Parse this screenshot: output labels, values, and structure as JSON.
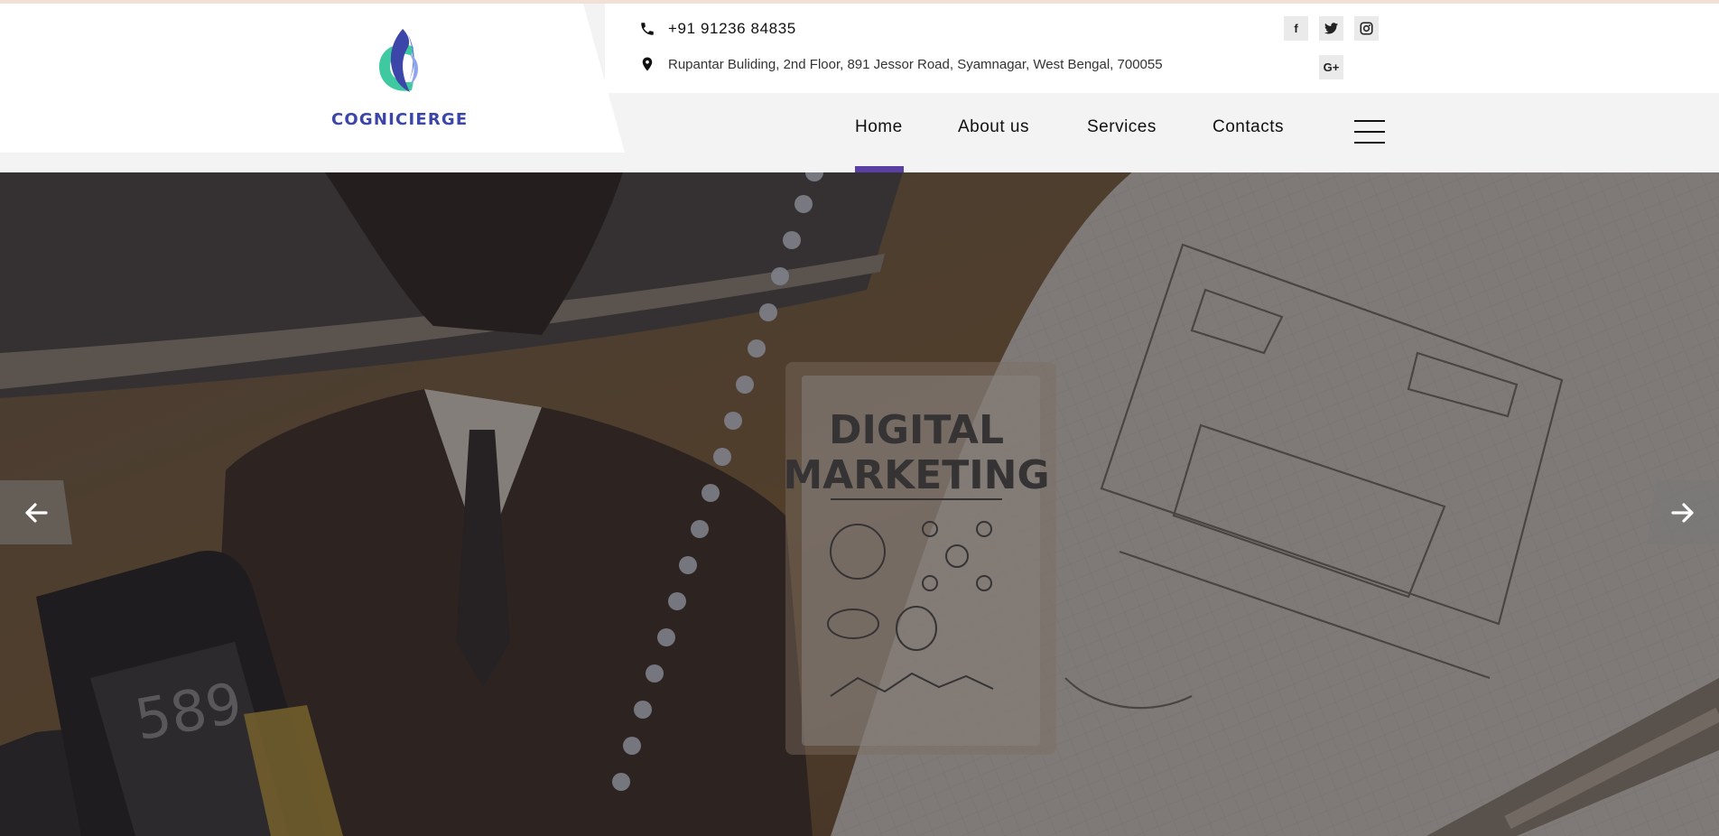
{
  "brand": {
    "name": "COGNICIERGE",
    "logo_icon": "c-flame-logo-icon"
  },
  "contact": {
    "phone": "+91 91236 84835",
    "phone_icon": "phone-icon",
    "address": "Rupantar Buliding, 2nd Floor, 891 Jessor Road, Syamnagar, West Bengal, 700055",
    "address_icon": "map-pin-icon"
  },
  "social": [
    {
      "name": "facebook-icon",
      "glyph": "f"
    },
    {
      "name": "twitter-icon",
      "glyph": "🐦"
    },
    {
      "name": "instagram-icon",
      "glyph": "◎"
    },
    {
      "name": "google-plus-icon",
      "glyph": "G+"
    }
  ],
  "nav": {
    "items": [
      {
        "label": "Home",
        "active": true
      },
      {
        "label": "About us",
        "active": false
      },
      {
        "label": "Services",
        "active": false
      },
      {
        "label": "Contacts",
        "active": false
      }
    ],
    "menu_icon": "hamburger-menu-icon"
  },
  "hero": {
    "image_subject": "businessman with laptop and notebook sketches",
    "clipboard_title_line1": "DIGITAL",
    "clipboard_title_line2": "MARKETING",
    "calculator_display": "589",
    "prev_icon": "arrow-left-icon",
    "next_icon": "arrow-right-icon"
  },
  "colors": {
    "accent": "#5a3fa4",
    "logo_text": "#3b46a8",
    "logo_teal": "#3ec9a0",
    "header_bg": "#f3f3f3"
  }
}
